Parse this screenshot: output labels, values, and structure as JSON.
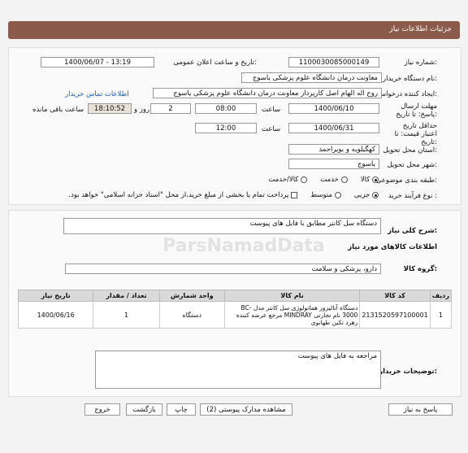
{
  "header": {
    "title": "جزئیات اطلاعات نیاز"
  },
  "fields": {
    "need_number_label": "شماره نیاز:",
    "need_number": "1100030085000149",
    "announce_label": "تاریخ و ساعت اعلان عمومی:",
    "announce_value": "1400/06/07 - 13:19",
    "buyer_org_label": "نام دستگاه خریدار:",
    "buyer_org": "معاونت درمان دانشگاه علوم پزشکی یاسوج",
    "creator_label": "ایجاد کننده درخواست:",
    "creator": "روح اله الهام اصل کارپرداز معاونت درمان دانشگاه علوم پزشکی یاسوج",
    "contact_link": "اطلاعات تماس خریدار",
    "deadline_label": "مهلت ارسال پاسخ: تا تاریخ:",
    "deadline_date": "1400/06/10",
    "hour_label": "ساعت",
    "deadline_time": "08:00",
    "days_value": "2",
    "days_label": "روز و",
    "remaining_time": "18:10:52",
    "remaining_label": "ساعت باقی مانده",
    "validity_label": "حداقل تاریخ اعتبار قیمت: تا تاریخ:",
    "validity_date": "1400/06/31",
    "validity_hour_label": "ساعت",
    "validity_time": "12:00",
    "province_label": "استان محل تحویل:",
    "province": "کهگیلویه و بویراحمد",
    "city_label": "شهر محل تحویل:",
    "city": "یاسوج",
    "category_label": "طبقه بندی موضوعی:",
    "category_options": [
      "کالا",
      "خدمت",
      "کالا/خدمت"
    ],
    "process_label": "نوع فرآیند خرید :",
    "process_options": [
      "جزیی",
      "متوسط"
    ],
    "payment_note": "پرداخت تمام یا بخشی از مبلغ خرید،از محل \"اسناد خزانه اسلامی\" خواهد بود."
  },
  "description": {
    "label": "شرح کلی نیاز:",
    "value": "دستگاه سل کانتر مطابق با فایل های پیوست"
  },
  "goods_section_title": "اطلاعات کالاهای مورد نیاز",
  "group": {
    "label": "گروه کالا:",
    "value": "دارو، پزشکی و سلامت"
  },
  "table": {
    "headers": [
      "ردیف",
      "کد کالا",
      "نام کالا",
      "واحد شمارش",
      "تعداد / مقدار",
      "تاریخ نیاز"
    ],
    "rows": [
      [
        "1",
        "2131520597100001",
        "دستگاه آنالیزور هماتولوژی سل کانتر مدل BC-3000 نام تجارتی MINDRAY مرجع عرضه کننده رهرد تکین طهانوی",
        "دستگاه",
        "1",
        "1400/06/16"
      ]
    ]
  },
  "buyer_notes": {
    "label": "توضیحات خریدار:",
    "value": "مراجعه به فایل های پیوست"
  },
  "buttons": {
    "reply": "پاسخ به نیاز",
    "docs": "مشاهده مدارک پیوستی (2)",
    "print": "چاپ",
    "back": "بازگشت",
    "exit": "خروج"
  },
  "watermark": "ParsNamadData"
}
